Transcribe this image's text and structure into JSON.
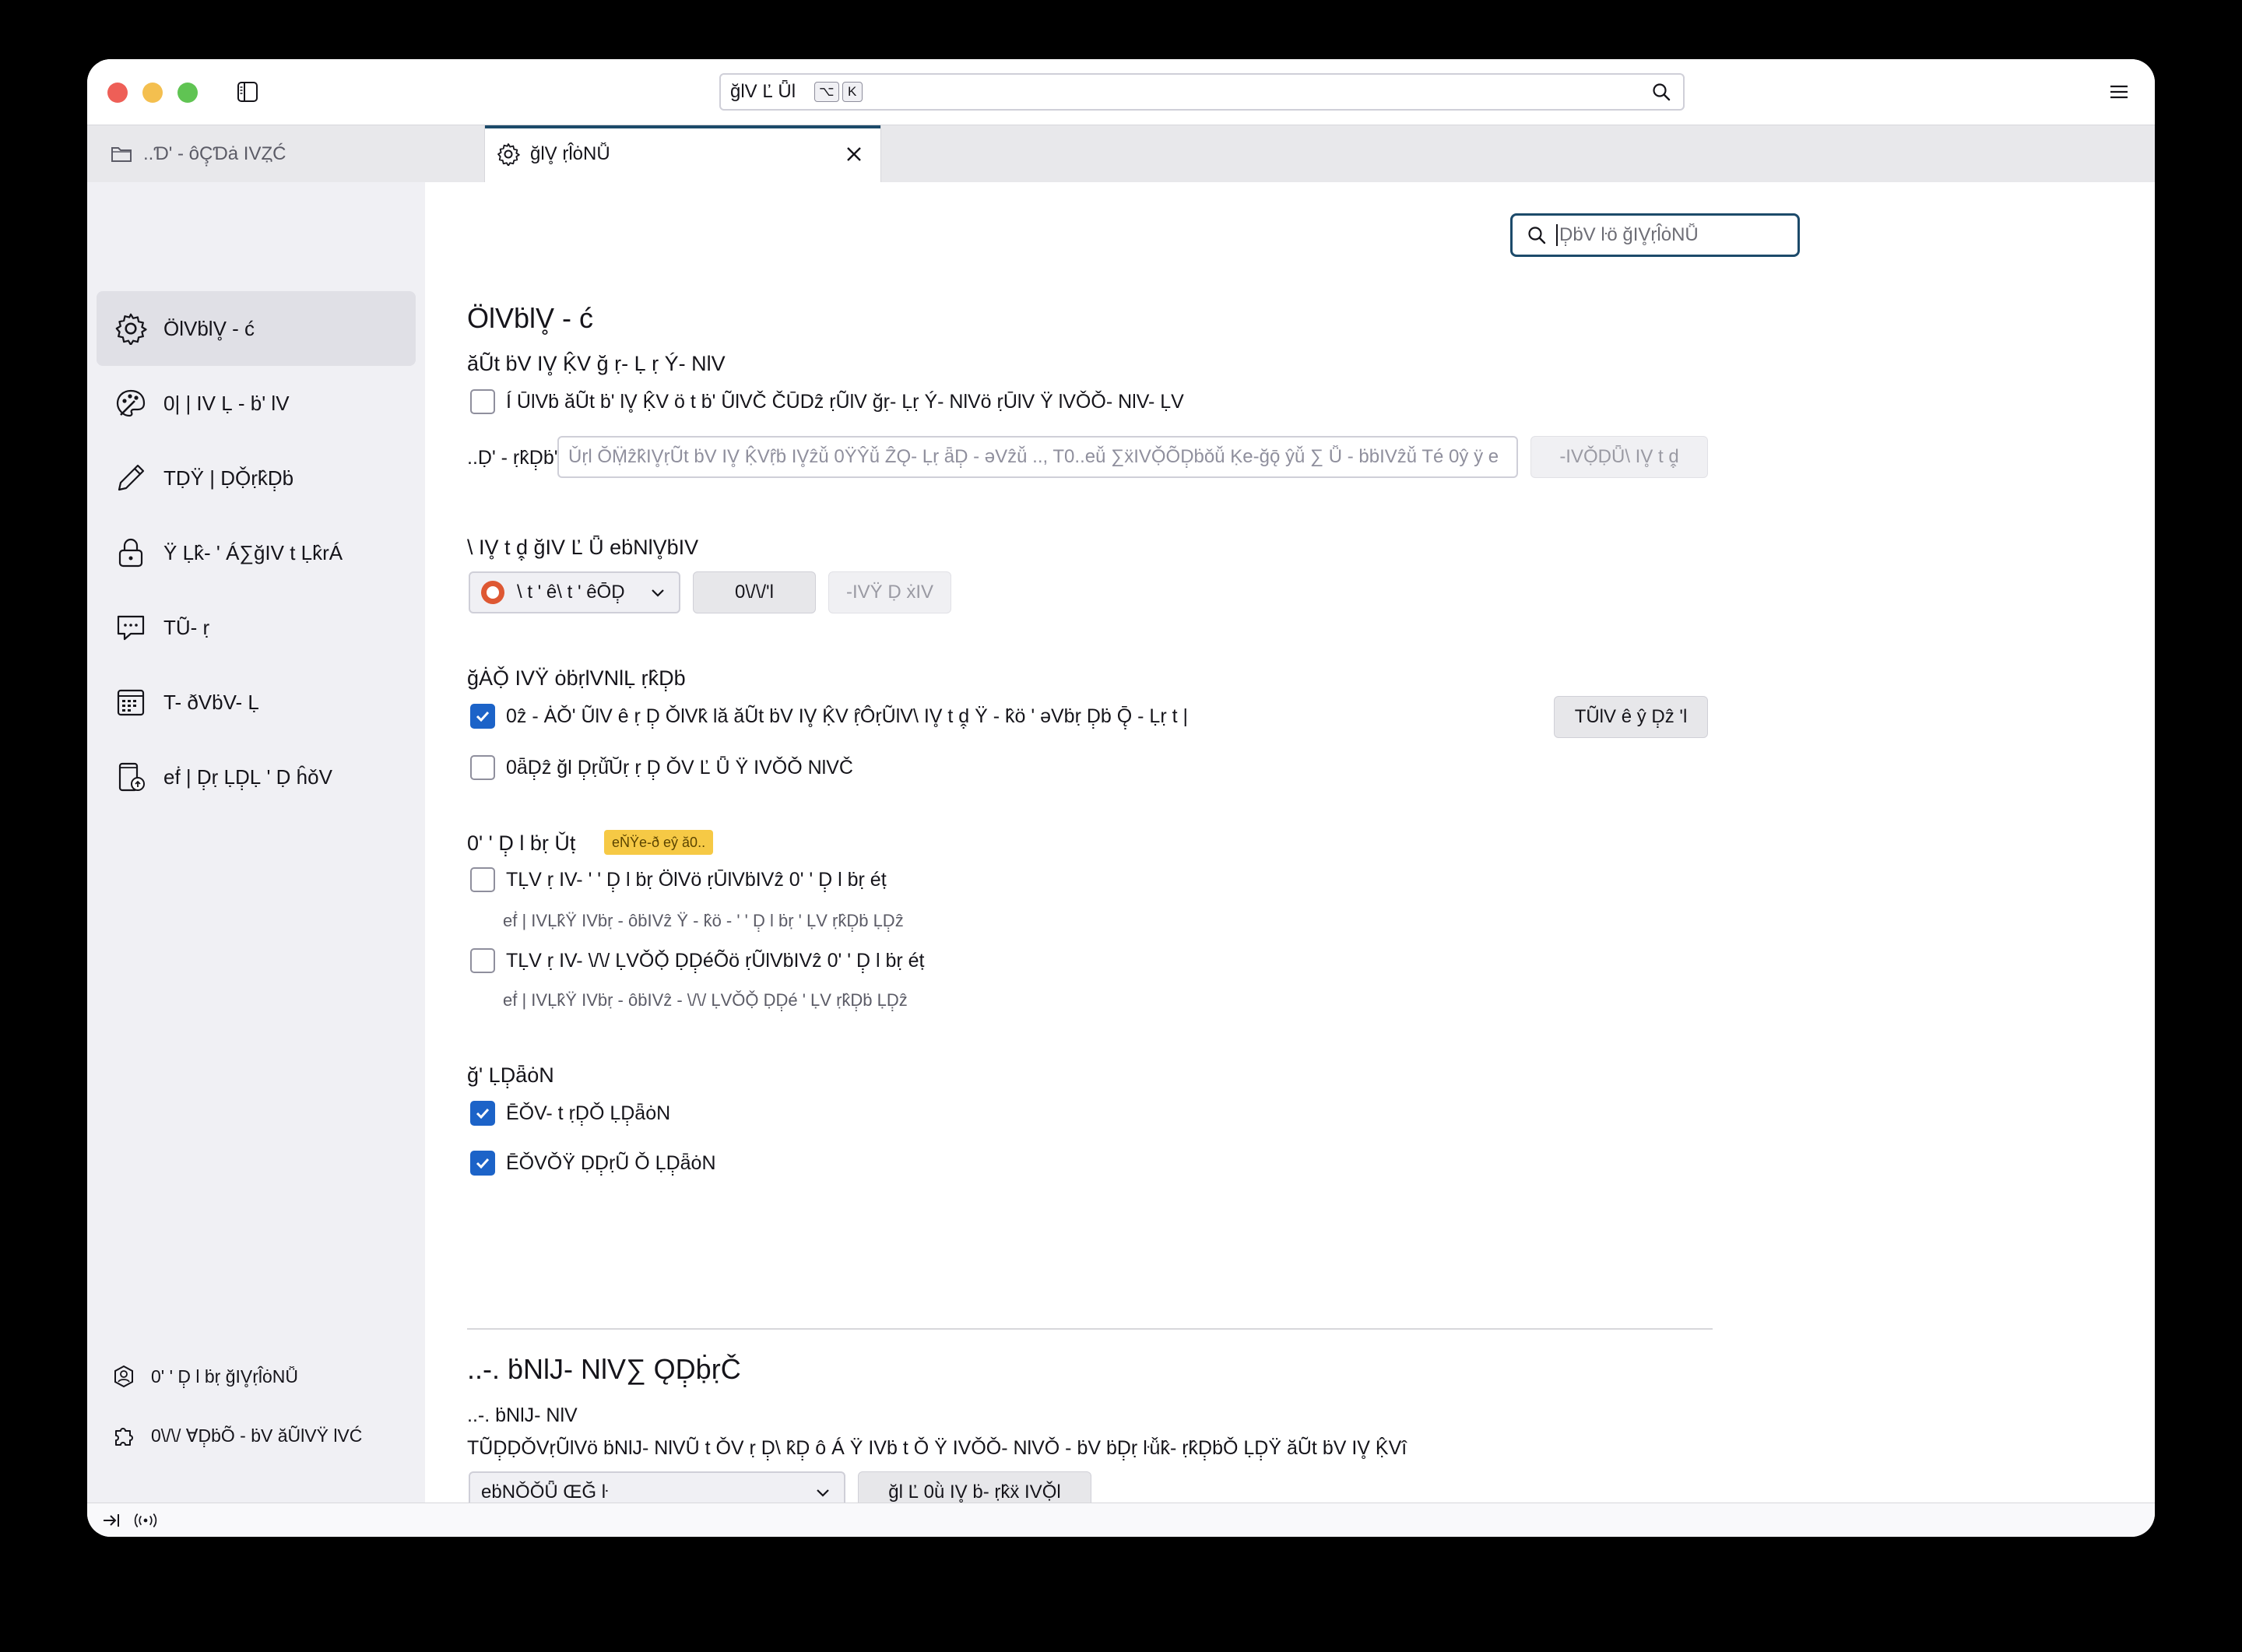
{
  "window": {
    "url_text": "ğlV Ľ Ǖl",
    "kbd_keys": [
      "⌥",
      "K"
    ]
  },
  "tabs": [
    {
      "label": "..Ɗ' - ôÇ̣Ɗȧ IVȤ̣Ć",
      "icon": "folder-icon"
    },
    {
      "label": "ğlV̥ ṛl̂ȯNǙ",
      "icon": "gear-icon"
    }
  ],
  "sidebar": {
    "items": [
      {
        "label": "ÖlVḃlV̥ - ć",
        "icon": "gear-icon"
      },
      {
        "label": "0| | IV Ḷ - ḃ' lV",
        "icon": "palette-icon"
      },
      {
        "label": "TḌŸ | ḌỌ̌ṛk̂Ḍ̣ḃ",
        "icon": "pencil-icon"
      },
      {
        "label": "Ÿ Ḷk̂- ' Á∑ğIV t Ḷk̂rÁ",
        "icon": "lock-icon"
      },
      {
        "label": "TŨ- ṛ",
        "icon": "chat-icon"
      },
      {
        "label": "T- ðVḃV- Ḷ",
        "icon": "calendar-icon"
      },
      {
        "label": "eḟ | Ḍ̣ṛ ḶḌ̣Ḷ ' Ḍ ĥǒV",
        "icon": "device-sync-icon"
      }
    ],
    "footer": [
      {
        "label": "0' ' Ḍ̣ l ḃṛ ğIV̥ṛl̂ȯNǙ",
        "icon": "account-icon"
      },
      {
        "label": "0\\/\\/ ⱯḌ̣ḃÕ - ḃV ăŨlVŸ lVĆ",
        "icon": "puzzle-icon"
      }
    ]
  },
  "main": {
    "find_placeholder": "Ḍ̣ḃV ŀö ğIV̥ṛl̂ȯNǙ",
    "general_title": "ÖlVḃlV̥ - ć",
    "startup": {
      "heading": "ăŨt ḃV IV̥ Ḳ̂V ğ ṛ- Ḷ ṛ Ý- NlV",
      "checkbox_label": "Í ŪlVḃ ăŨt ḃ' lV̥ Ḳ̂V ö t ḃ' ŨlVČ ČŪDẑ ṛŨlV ğṛ- Ḷṛ Ý- NlVö ṛŪlV Ÿ lVǑǑ- NlV- ḶV",
      "homepage_label": "..Ḍ' - ṛk̂Ḍ̣ḃ'l",
      "homepage_placeholder": "Ǔṛl ŎṂ̈ẑk̂IV̥ṛŨt ḃV IV̥ Ḳ̂Vṛ̂ḃ IV̥ẑǚ 0ŸŶǚ ẐǪ- Ḷṛ ǟḌ̣ - ǝVẑǚ .., T0..eǚ ∑ẍIVỌ̌ÕḌ̣ḃǒǚ Ḳe-ğǭ ŷǚ ∑ Ǚ - ḃḃIVẑǚ Té 0ŷ ÿ e",
      "restore_btn": "-IVỌ̌ḌǕ\\ IV̥ t ḓ̣"
    },
    "search": {
      "heading": "\\ IV̥ t ḓ̣ ğIV Ľ Ǖ eḃNlV̥ḃIV",
      "engine": "\\ t ' ê\\ t ' êŌḌ̣",
      "add_btn": "0\\/\\/'l",
      "remove_btn": "-IVŸ Ḍ ẋIV"
    },
    "system": {
      "heading": "ğȦỌ̌ IVŸ ȯḃṛlVNlḶ ṛk̂Ḍ̣ḃ",
      "default_checkbox": "0ẑ - ȦǑ' ŨlV ê ṛ Ḍ̣ ǑlVk̂ lă ăŨt ḃV IV̥ Ḳ̂V ṛ̂ÔṛŨlV\\ IV̥ t ḓ̣ Ÿ - k̂ö ' ǝVḃṛ Ḍ̣ḃ Ǭ̣ - Ḷṛ t |",
      "make_default_btn": "TŨlV ê ŷ Ḍ̣ẑ 'l",
      "second_checkbox": "0ǟḌ̣ẑ ğl Ḍ̣ṛǚ̂Ŭṛ ṛ Ḍ̣ ǑV Ľ Ǖ Ÿ IVǑǑ NlVČ"
    },
    "updates": {
      "heading": "0' ' Ḍ̣ l ḃṛ Ǔṭ",
      "badge": "eŇŸe-ð eŷ ă0..",
      "opt1_label": "TḶV ṛ IV- ' ' Ḍ̣ l ḃṛ ÖlVö ṛŪlVḃIVẑ 0' ' Ḍ̣ l ḃṛ éṭ",
      "opt1_desc": "eḟ | IVḶk̂Ÿ IVḃṛ - ôḃIVẑ Ÿ - k̂ö - ' ' Ḍ̣ l ḃṛ ' ḶV ṛk̂Ḍ̣ḃ ḶḌ̣ẑ",
      "opt2_label": "TḶV ṛ IV- \\/\\/ ḶVǑỌ̌ ḌḌ̣éÕö ṛŨlVḃIVẑ 0' ' Ḍ̣ l ḃṛ éṭ",
      "opt2_desc": "eḟ | IVḶk̂Ÿ IVḃṛ - ôḃIVẑ - \\/\\/ ḶVǑỌ̌ ḌḌ̣é ' ḶV ṛk̂Ḍ̣ḃ ḶḌ̣ẑ"
    },
    "tabs_section": {
      "heading": "ğ' ḶḌ̣ǟȯN",
      "opt1": "ĒǑV- t ṛḌ̣Ǒ ḶḌ̣ǟȯN",
      "opt2": "ĒǑVǑŸ ḌḌ̣ṛŨ Ǒ ḶḌ̣ǟȯN"
    },
    "language": {
      "title": "..-. ḃNlJ- NlV∑ ǪḌ̣ḅ̇ṛČ",
      "heading": "..-. ḃNlJ- NlV",
      "desc": "TŨḌ̣ḌǑVṛŨlVö ḃNlJ- NlVŨ t ǑV ṛ Ḍ̣\\ k̂Ḍ̣ ô Á Ÿ IVḃ t Ǒ Ÿ IVǑǑ- NlVǑ - ḃV ḃḌ̣ṛ ŀǚk̂- ṛk̂Ḍ̣ḃǑ ḶḌ̣Ÿ ăŨt ḃV IV̥ Ḳ̂Vî",
      "select_value": "eḃNǑǑǕ ŒĞ ŀ",
      "alt_btn": "ğl Ľ 0ǜ IV̥ ḃ- ṛk̂ẍ IVỌ̌l"
    }
  }
}
